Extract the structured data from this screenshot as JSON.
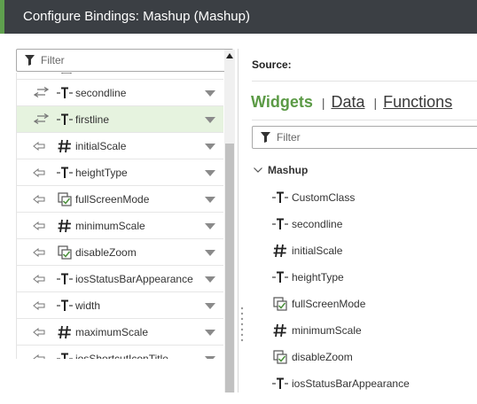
{
  "window": {
    "title": "Configure Bindings: Mashup (Mashup)"
  },
  "colors": {
    "titlebar": "#3b3f44",
    "accent": "#5fa04e",
    "selected_row": "#e6f3df",
    "active_tab": "#5b9a45"
  },
  "left_panel": {
    "filter_placeholder": "Filter",
    "partial_top_label": "visible",
    "properties": [
      {
        "name": "secondline",
        "type": "string",
        "binding": "both",
        "selected": false
      },
      {
        "name": "firstline",
        "type": "string",
        "binding": "both",
        "selected": true
      },
      {
        "name": "initialScale",
        "type": "number",
        "binding": "in",
        "selected": false
      },
      {
        "name": "heightType",
        "type": "string",
        "binding": "in",
        "selected": false
      },
      {
        "name": "fullScreenMode",
        "type": "boolean",
        "binding": "in",
        "selected": false
      },
      {
        "name": "minimumScale",
        "type": "number",
        "binding": "in",
        "selected": false
      },
      {
        "name": "disableZoom",
        "type": "boolean",
        "binding": "in",
        "selected": false
      },
      {
        "name": "iosStatusBarAppearance",
        "type": "string",
        "binding": "in",
        "selected": false
      },
      {
        "name": "width",
        "type": "string",
        "binding": "in",
        "selected": false
      },
      {
        "name": "maximumScale",
        "type": "number",
        "binding": "in",
        "selected": false
      },
      {
        "name": "iosShortcutIconTitle",
        "type": "string",
        "binding": "in",
        "selected": false
      }
    ]
  },
  "right_panel": {
    "source_label": "Source:",
    "tabs": [
      "Widgets",
      "Data",
      "Functions"
    ],
    "active_tab": "Widgets",
    "tab_separator": "|",
    "filter_placeholder": "Filter",
    "group_label": "Mashup",
    "items": [
      {
        "name": "CustomClass",
        "type": "string"
      },
      {
        "name": "secondline",
        "type": "string"
      },
      {
        "name": "initialScale",
        "type": "number"
      },
      {
        "name": "heightType",
        "type": "string"
      },
      {
        "name": "fullScreenMode",
        "type": "boolean"
      },
      {
        "name": "minimumScale",
        "type": "number"
      },
      {
        "name": "disableZoom",
        "type": "boolean"
      },
      {
        "name": "iosStatusBarAppearance",
        "type": "string"
      }
    ]
  }
}
